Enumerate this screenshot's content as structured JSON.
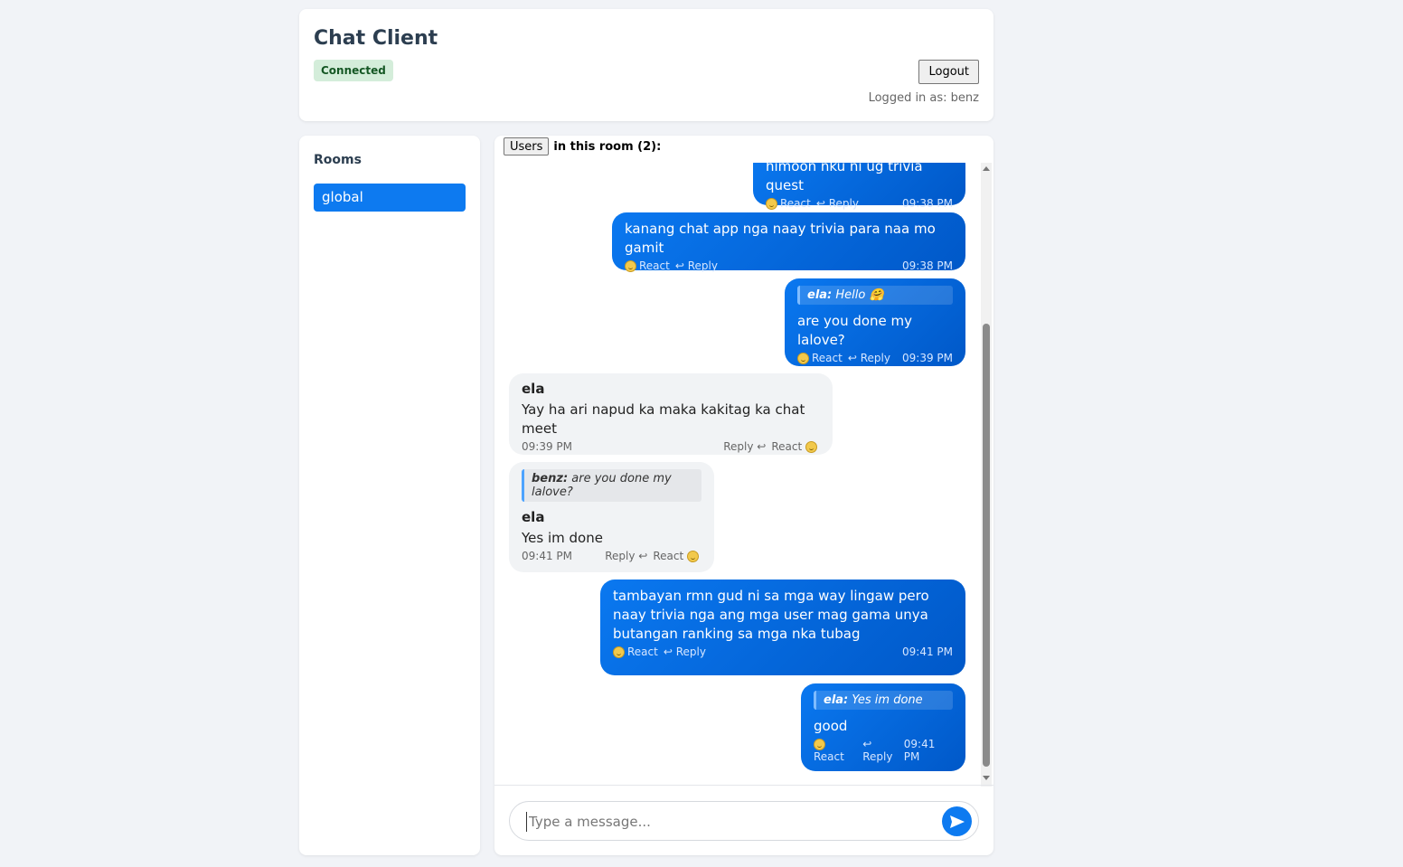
{
  "header": {
    "title": "Chat Client",
    "status": "Connected",
    "logout_label": "Logout",
    "logged_in_text": "Logged in as: benz"
  },
  "rooms": {
    "title": "Rooms",
    "items": [
      {
        "label": "global",
        "active": true
      }
    ]
  },
  "chat": {
    "users_button": "Users",
    "users_suffix": "in this room (2):",
    "input_placeholder": "Type a message...",
    "messages": [
      {
        "type": "sent",
        "text": "himoon nku ni ug trivia quest",
        "react": "React",
        "reply": "↩ Reply",
        "time": "09:38 PM"
      },
      {
        "type": "sent",
        "text": "kanang chat app nga naay trivia para naa mo gamit",
        "react": "React",
        "reply": "↩ Reply",
        "time": "09:38 PM"
      },
      {
        "type": "sent",
        "quote_author": "ela:",
        "quote_text": "Hello 🤗",
        "text": "are you done my lalove?",
        "react": "React",
        "reply": "↩ Reply",
        "time": "09:39 PM"
      },
      {
        "type": "recv",
        "sender": "ela",
        "text": "Yay ha ari napud ka maka kakitag ka chat meet",
        "time": "09:39 PM",
        "reply": "Reply ↩",
        "react": "React"
      },
      {
        "type": "recv",
        "quote_author": "benz:",
        "quote_text": "are you done my lalove?",
        "sender": "ela",
        "text": "Yes im done",
        "time": "09:41 PM",
        "reply": "Reply ↩",
        "react": "React"
      },
      {
        "type": "sent",
        "text": "tambayan rmn gud ni sa mga way lingaw pero naay trivia nga ang mga user mag gama unya butangan ranking sa mga nka tubag",
        "react": "React",
        "reply": "↩ Reply",
        "time": "09:41 PM"
      },
      {
        "type": "sent",
        "quote_author": "ela:",
        "quote_text": "Yes im done",
        "text": "good",
        "react": "React",
        "reply": "↩ Reply",
        "time": "09:41 PM"
      }
    ]
  },
  "colors": {
    "accent": "#0d7af0",
    "status_bg": "#d4edda",
    "status_text": "#155724",
    "received_bg": "#f1f3f5"
  }
}
